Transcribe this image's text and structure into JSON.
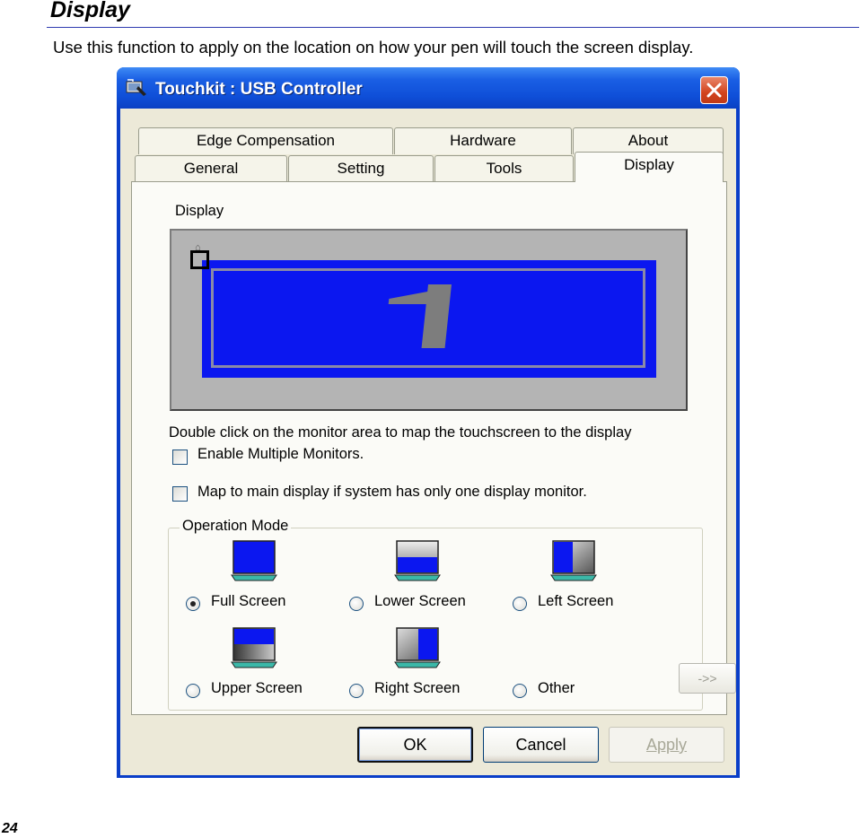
{
  "doc": {
    "heading": "Display",
    "description": "Use this function to apply on the location on how your pen will touch the screen display.",
    "page_number": "24"
  },
  "window": {
    "title": "Touchkit : USB Controller",
    "tabs_back_row": [
      "Edge Compensation",
      "Hardware",
      "About"
    ],
    "tabs_front_row": [
      "General",
      "Setting",
      "Tools",
      "Display"
    ],
    "active_tab": "Display"
  },
  "display_panel": {
    "section_label": "Display",
    "monitor_number": "1",
    "instruction": "Double click on the monitor area to map the touchscreen to the display",
    "enable_multiple_monitors": {
      "label": "Enable Multiple Monitors.",
      "checked": false
    },
    "map_to_main": {
      "label": "Map to main display if system has only one display monitor.",
      "checked": false
    }
  },
  "operation_mode": {
    "title": "Operation Mode",
    "options": [
      {
        "label": "Full Screen",
        "icon": "full-screen-monitor-icon",
        "selected": true
      },
      {
        "label": "Lower Screen",
        "icon": "lower-screen-monitor-icon",
        "selected": false
      },
      {
        "label": "Left Screen",
        "icon": "left-screen-monitor-icon",
        "selected": false
      },
      {
        "label": "Upper Screen",
        "icon": "upper-screen-monitor-icon",
        "selected": false
      },
      {
        "label": "Right Screen",
        "icon": "right-screen-monitor-icon",
        "selected": false
      },
      {
        "label": "Other",
        "icon": "",
        "selected": false
      }
    ],
    "more_button": "->>"
  },
  "buttons": {
    "ok": "OK",
    "cancel": "Cancel",
    "apply": "Apply"
  },
  "colors": {
    "titlebar": "#0f4fd8",
    "screen_blue": "#0b17f0",
    "dialog_face": "#ece9d8",
    "close_red": "#d2441d"
  }
}
